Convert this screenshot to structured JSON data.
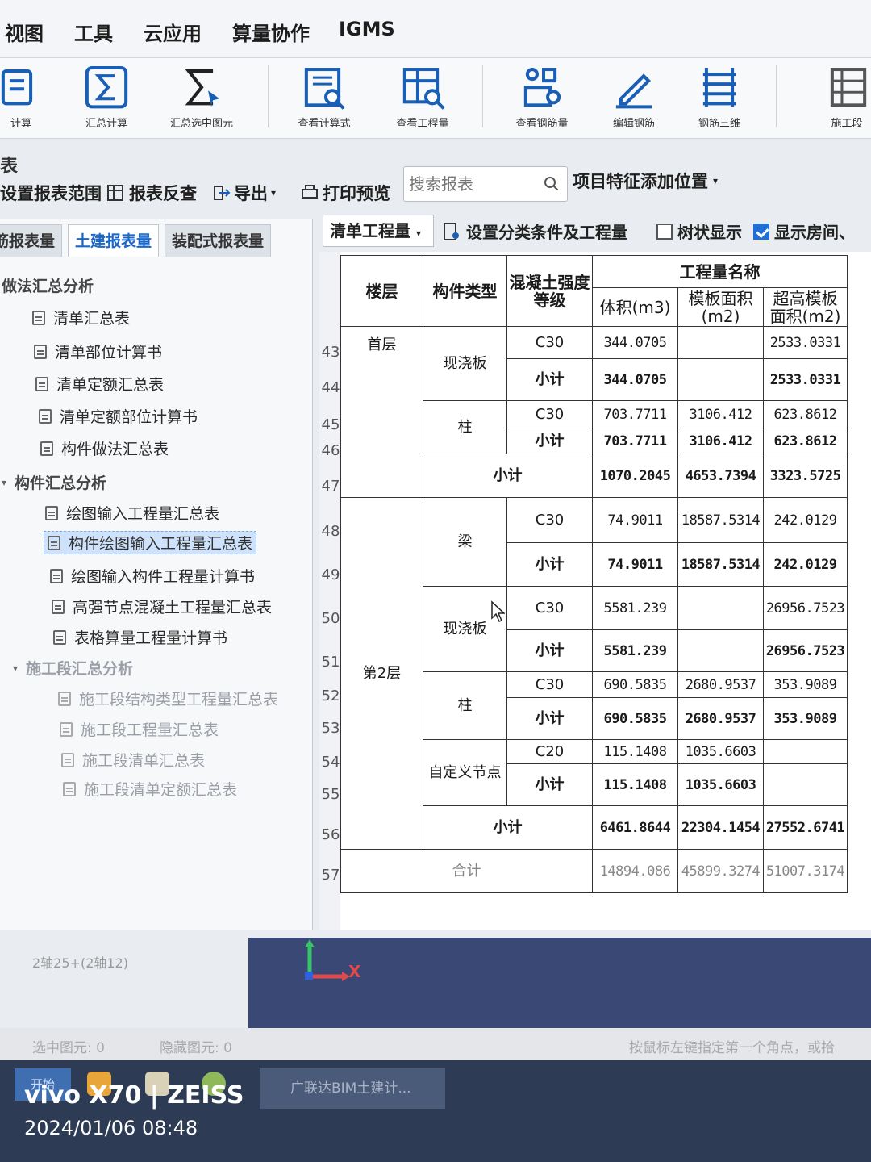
{
  "menu": {
    "items": [
      "视图",
      "工具",
      "云应用",
      "算量协作",
      "IGMS"
    ]
  },
  "ribbon": {
    "buttons": [
      {
        "icon": "calculate-icon",
        "label": "计算"
      },
      {
        "icon": "sum-calc-icon",
        "label": "汇总计算"
      },
      {
        "icon": "sum-selected-icon",
        "label": "汇总选中图元"
      },
      {
        "icon": "view-formula-icon",
        "label": "查看计算式"
      },
      {
        "icon": "view-quantity-icon",
        "label": "查看工程量"
      },
      {
        "icon": "view-rebar-icon",
        "label": "查看钢筋量"
      },
      {
        "icon": "edit-rebar-icon",
        "label": "编辑钢筋"
      },
      {
        "icon": "rebar-3d-icon",
        "label": "钢筋三维"
      },
      {
        "icon": "construction-icon",
        "label": "施工段"
      }
    ]
  },
  "panel": {
    "title": "表"
  },
  "toolbar": {
    "set_range": "设置报表范围",
    "reverse_check": "报表反查",
    "export": "导出",
    "print_preview": "打印预览",
    "search_placeholder": "搜索报表",
    "feature_position": "项目特征添加位置"
  },
  "tabs": [
    "钢筋报表量",
    "土建报表量",
    "装配式报表量"
  ],
  "tree": [
    {
      "label": "做法汇总分析",
      "group": true
    },
    {
      "label": "清单汇总表"
    },
    {
      "label": "清单部位计算书"
    },
    {
      "label": "清单定额汇总表"
    },
    {
      "label": "清单定额部位计算书"
    },
    {
      "label": "构件做法汇总表"
    },
    {
      "label": "构件汇总分析",
      "group": true
    },
    {
      "label": "绘图输入工程量汇总表"
    },
    {
      "label": "构件绘图输入工程量汇总表",
      "selected": true
    },
    {
      "label": "绘图输入构件工程量计算书"
    },
    {
      "label": "高强节点混凝土工程量汇总表"
    },
    {
      "label": "表格算量工程量计算书"
    },
    {
      "label": "施工段汇总分析",
      "group": true
    },
    {
      "label": "施工段结构类型工程量汇总表"
    },
    {
      "label": "施工段工程量汇总表"
    },
    {
      "label": "施工段清单汇总表"
    },
    {
      "label": "施工段清单定额汇总表"
    }
  ],
  "report_toolbar": {
    "type_select": "清单工程量",
    "classify": "设置分类条件及工程量",
    "tree_display": "树状显示",
    "show_room": "显示房间、"
  },
  "table": {
    "headers": {
      "floor": "楼层",
      "type": "构件类型",
      "grade": "混凝土强度等级",
      "group": "工程量名称",
      "volume": "体积(m3)",
      "formwork": "模板面积(m2)",
      "high_formwork": "超高模板面积(m2)"
    },
    "floors": [
      "首层",
      "第2层"
    ],
    "types": [
      "现浇板",
      "柱",
      "梁",
      "现浇板",
      "柱",
      "自定义节点"
    ],
    "rownums": [
      "43",
      "44",
      "45",
      "46",
      "47",
      "48",
      "49",
      "50",
      "51",
      "52",
      "53",
      "54",
      "55",
      "56",
      "57"
    ],
    "rows": [
      {
        "grade": "C30",
        "v": "344.0705",
        "f": "",
        "h": "2533.0331"
      },
      {
        "grade": "小计",
        "v": "344.0705",
        "f": "",
        "h": "2533.0331"
      },
      {
        "grade": "C30",
        "v": "703.7711",
        "f": "3106.412",
        "h": "623.8612"
      },
      {
        "grade": "小计",
        "v": "703.7711",
        "f": "3106.412",
        "h": "623.8612"
      },
      {
        "grade": "小计",
        "v": "1070.2045",
        "f": "4653.7394",
        "h": "3323.5725"
      },
      {
        "grade": "C30",
        "v": "74.9011",
        "f": "18587.5314",
        "h": "242.0129"
      },
      {
        "grade": "小计",
        "v": "74.9011",
        "f": "18587.5314",
        "h": "242.0129"
      },
      {
        "grade": "C30",
        "v": "5581.239",
        "f": "",
        "h": "26956.7523"
      },
      {
        "grade": "小计",
        "v": "5581.239",
        "f": "",
        "h": "26956.7523"
      },
      {
        "grade": "C30",
        "v": "690.5835",
        "f": "2680.9537",
        "h": "353.9089"
      },
      {
        "grade": "小计",
        "v": "690.5835",
        "f": "2680.9537",
        "h": "353.9089"
      },
      {
        "grade": "C20",
        "v": "115.1408",
        "f": "1035.6603",
        "h": ""
      },
      {
        "grade": "小计",
        "v": "115.1408",
        "f": "1035.6603",
        "h": ""
      },
      {
        "grade": "小计",
        "v": "6461.8644",
        "f": "22304.1454",
        "h": "27552.6741"
      },
      {
        "grade": "合计",
        "v": "14894.086",
        "f": "45899.3274",
        "h": "51007.3174"
      }
    ]
  },
  "status": {
    "left_info": "2轴25+(2轴12)",
    "selected": "选中图元: 0",
    "hidden": "隐藏图元: 0",
    "hint": "按鼠标左键指定第一个角点，或拾"
  },
  "taskbar": {
    "start": "开始",
    "app": "广联达BIM土建计..."
  },
  "watermark": {
    "brand": "vivo X70 | ZEISS",
    "datetime": "2024/01/06 08:48"
  },
  "axis": {
    "x_label": "X"
  }
}
